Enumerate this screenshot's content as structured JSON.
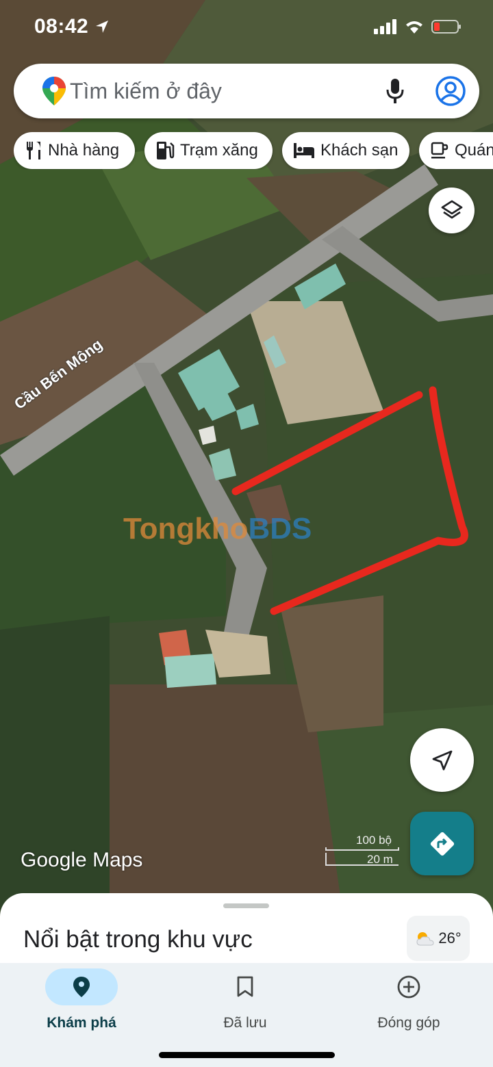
{
  "status_bar": {
    "time": "08:42"
  },
  "search": {
    "placeholder": "Tìm kiếm ở đây"
  },
  "chips": [
    {
      "label": "Nhà hàng",
      "icon": "restaurant-icon"
    },
    {
      "label": "Trạm xăng",
      "icon": "gas-station-icon"
    },
    {
      "label": "Khách sạn",
      "icon": "hotel-icon"
    },
    {
      "label": "Quán",
      "icon": "cafe-icon"
    }
  ],
  "map": {
    "road_label": "Cầu Bến Mộng",
    "watermark_part1": "Tongkho",
    "watermark_part2": "BDS",
    "brand": "Google Maps",
    "scale_imperial": "100 bộ",
    "scale_metric": "20 m",
    "highlight_color": "#e8281e"
  },
  "sheet": {
    "title": "Nổi bật trong khu vực",
    "temperature": "26°"
  },
  "nav": {
    "explore": "Khám phá",
    "saved": "Đã lưu",
    "contribute": "Đóng góp"
  },
  "colors": {
    "accent": "#147e8a",
    "nav_active_bg": "#c2e7ff"
  }
}
